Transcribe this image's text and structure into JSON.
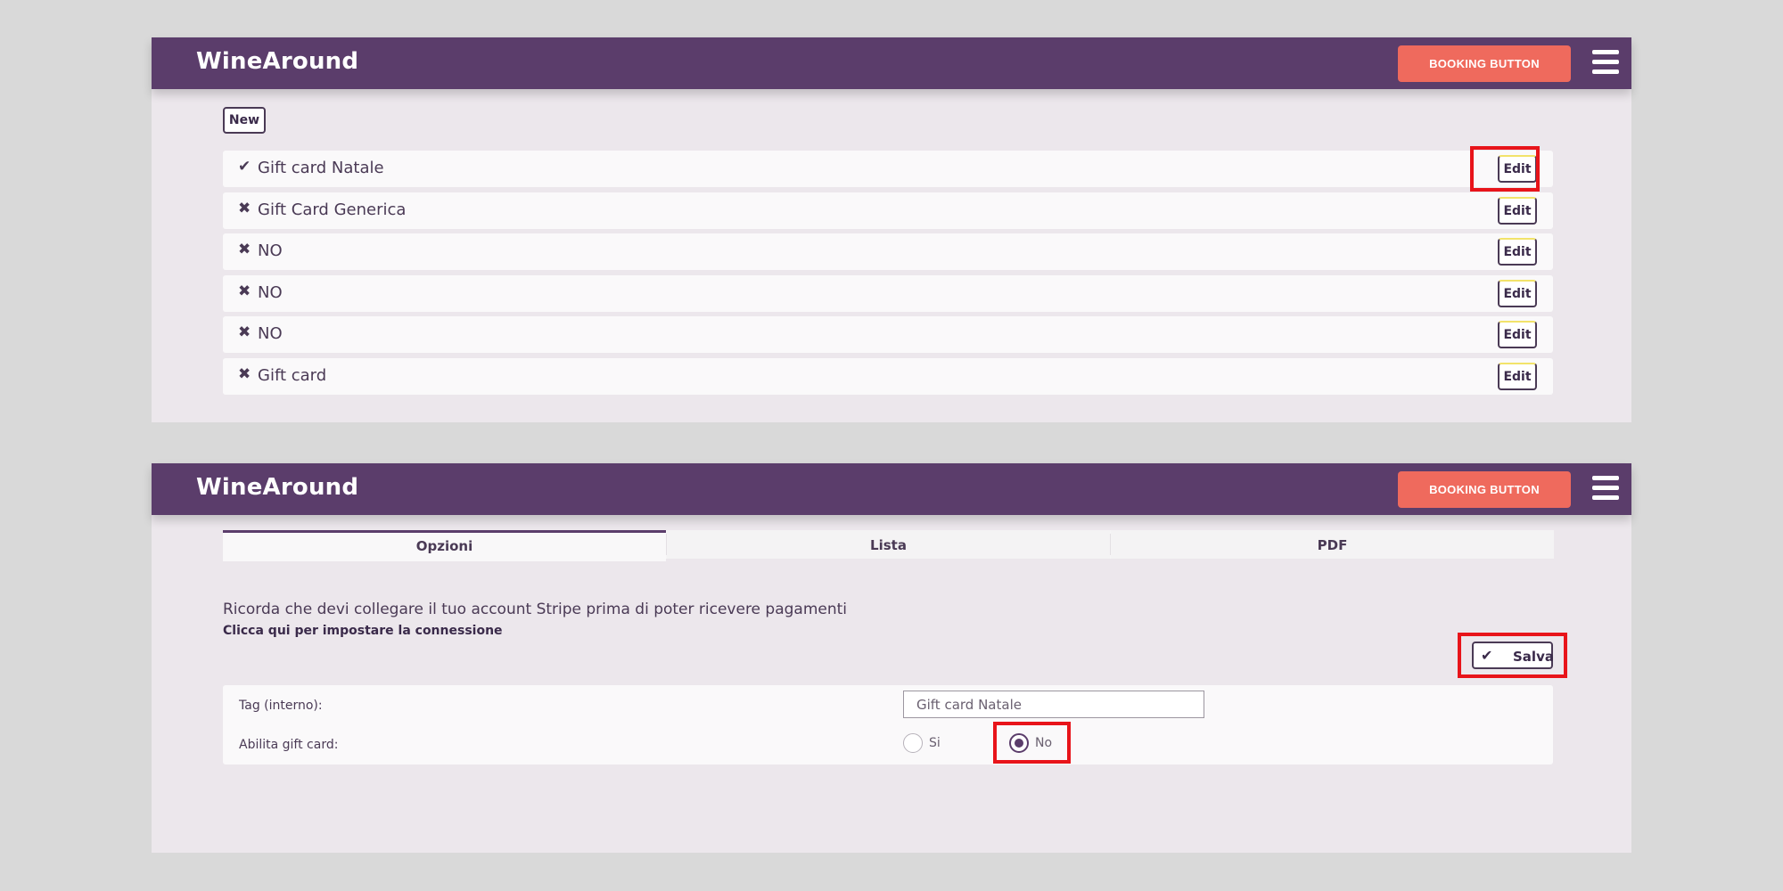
{
  "app": {
    "brand": "WineAround",
    "booking_button": "BOOKING BUTTON"
  },
  "list_view": {
    "new_button": "New",
    "edit_label": "Edit",
    "items": [
      {
        "status": "enabled",
        "icon": "check-icon",
        "glyph": "✔",
        "label": "Gift card Natale"
      },
      {
        "status": "disabled",
        "icon": "x-icon",
        "glyph": "✖",
        "label": "Gift Card Generica"
      },
      {
        "status": "disabled",
        "icon": "x-icon",
        "glyph": "✖",
        "label": "NO"
      },
      {
        "status": "disabled",
        "icon": "x-icon",
        "glyph": "✖",
        "label": "NO"
      },
      {
        "status": "disabled",
        "icon": "x-icon",
        "glyph": "✖",
        "label": "NO"
      },
      {
        "status": "disabled",
        "icon": "x-icon",
        "glyph": "✖",
        "label": "Gift card"
      }
    ]
  },
  "edit_view": {
    "tabs": [
      {
        "label": "Opzioni",
        "active": true
      },
      {
        "label": "Lista",
        "active": false
      },
      {
        "label": "PDF",
        "active": false
      }
    ],
    "notice": "Ricorda che devi collegare il tuo account Stripe prima di poter ricevere pagamenti",
    "notice_link": "Clicca qui per impostare la connessione",
    "save_button": "Salva",
    "form": {
      "tag_label": "Tag (interno):",
      "tag_value": "Gift card Natale",
      "enable_label": "Abilita gift card:",
      "options": [
        {
          "label": "Si",
          "selected": false
        },
        {
          "label": "No",
          "selected": true
        }
      ]
    }
  },
  "colors": {
    "navbar": "#5b3d6b",
    "booking_button": "#ef6a5d",
    "highlight": "#e8141a",
    "panel_bg": "#ece7ec"
  }
}
